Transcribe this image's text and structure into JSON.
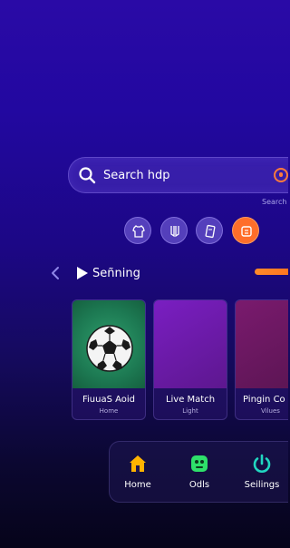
{
  "search": {
    "placeholder": "Search hdp",
    "hint": "Search"
  },
  "quick_actions": [
    {
      "icon": "shirt-icon"
    },
    {
      "icon": "boots-icon"
    },
    {
      "icon": "card-icon"
    },
    {
      "icon": "ticket-icon",
      "color": "#ff6e2a"
    }
  ],
  "section": {
    "title": "Señning",
    "accent": "#ff7a20"
  },
  "cards": [
    {
      "title": "FiuuaS Aoid",
      "subtitle": "Home",
      "icon": "soccer-ball-icon"
    },
    {
      "title": "Live Match",
      "subtitle": "Light"
    },
    {
      "title": "Pingin Co",
      "subtitle": "Vilues"
    }
  ],
  "nav": [
    {
      "label": "Home",
      "icon": "home-icon",
      "color": "#ffb300"
    },
    {
      "label": "Odls",
      "icon": "odds-icon",
      "color": "#2ee06a"
    },
    {
      "label": "Seilings",
      "icon": "power-icon",
      "color": "#21d6c0"
    }
  ]
}
